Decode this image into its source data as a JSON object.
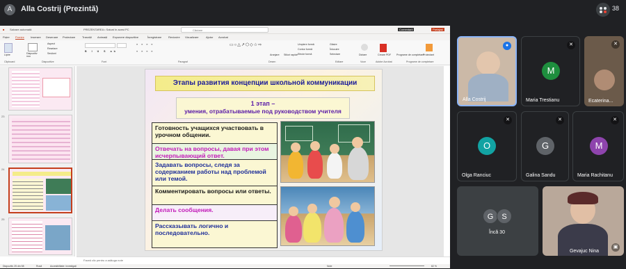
{
  "meeting": {
    "presenter_initial": "A",
    "presenter_label": "Alla Costrij (Prezintă)",
    "people_count": "38"
  },
  "powerpoint": {
    "titlebar": {
      "autosave": "Salvare automată",
      "filename": "PREZENTAREA • Salvat în acest PC",
      "search_placeholder": "Căutare",
      "comments": "Comentarii",
      "share": "Partajați"
    },
    "tabs": [
      "Fișier",
      "Pornire",
      "Inserare",
      "Desenare",
      "Proiectare",
      "Tranziții",
      "Animații",
      "Expunere diapozitive",
      "Înregistrare",
      "Revizuire",
      "Vizualizare",
      "Ajutor",
      "Acrobat"
    ],
    "ribbon_groups": [
      "Clipboard",
      "Diapozitive",
      "Font",
      "Paragraf",
      "Desen",
      "Editare",
      "Voce",
      "Adobe Acrobat",
      "Programe de completare"
    ],
    "ribbon_buttons": {
      "paste": "Lipire",
      "new_slide": "Diapozitiv nou",
      "layout": "Aspect",
      "reset": "Resetare",
      "sections": "Secțiuni",
      "arrange": "Aranjare",
      "quick_styles": "Stiluri rapide",
      "shape_fill": "Umplere formă",
      "shape_outline": "Contur formă",
      "shape_effects": "Efecte formă",
      "find": "Găsire",
      "replace": "Înlocuire",
      "select": "Selectare",
      "dictate": "Dictare",
      "create_pdf": "Creare PDF",
      "designer": "Proiectant",
      "addins": "Programe de completare"
    },
    "thumb_numbers": [
      "23",
      "24",
      "25"
    ],
    "notes_placeholder": "Faceți clic pentru a adăuga note",
    "status": {
      "slide_info": "Diapozitiv 25 din 58",
      "language": "Rusă",
      "accessibility": "Accesibilitate: investigați",
      "notes": "Note",
      "zoom": "82 %"
    }
  },
  "slide": {
    "title": "Этапы развития концепции школьной коммуникации",
    "stage_line1": "1 этап –",
    "stage_line2": "умения, отрабатываемые под руководством учителя",
    "rows": [
      {
        "text": "Готовность учащихся участвовать в урочном общении.",
        "color": "#1a1a1a"
      },
      {
        "text": "Отвечать на вопросы, давая при этом исчерпывающий ответ.",
        "color": "#c21ab8"
      },
      {
        "text": "Задавать вопросы, следя за содержанием работы над проблемой или темой.",
        "color": "#1f2f99"
      },
      {
        "text": "Комментировать вопросы или ответы.",
        "color": "#1a1a1a"
      },
      {
        "text": "Делать сообщения.",
        "color": "#c21ab8"
      },
      {
        "text": "Рассказывать логично и последовательно.",
        "color": "#1f2f99"
      }
    ]
  },
  "participants": [
    {
      "name": "Alla Costrij",
      "initial": "",
      "color": "#8a7f74"
    },
    {
      "name": "Maria Trestianu",
      "initial": "M",
      "color": "#1e8e3e"
    },
    {
      "name": "Ecaterina...",
      "initial": "",
      "color": "#6b5a4a"
    },
    {
      "name": "Olga Ranciuc",
      "initial": "O",
      "color": "#12a3a3"
    },
    {
      "name": "Galina Sandu",
      "initial": "G",
      "color": "#5f6368"
    },
    {
      "name": "Maria Rachitanu",
      "initial": "M",
      "color": "#8e44ad"
    },
    {
      "name": "Încă 30",
      "initial": "",
      "color": "#3c4043"
    },
    {
      "name": "Gevajuc Nina",
      "initial": "",
      "color": "#b9a89a"
    }
  ],
  "more_initials": [
    "G",
    "S"
  ]
}
